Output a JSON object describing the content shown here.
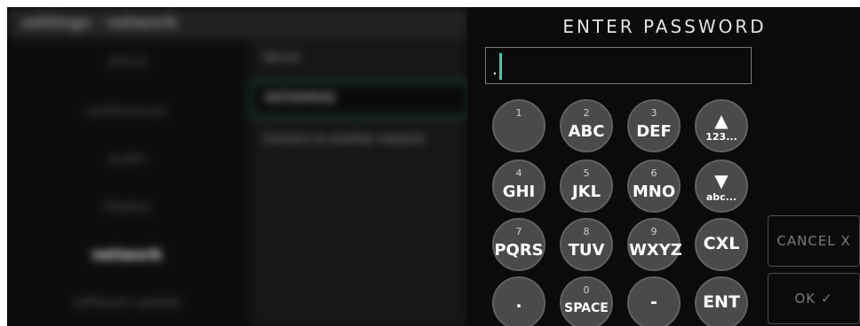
{
  "background": {
    "header": "settings · network",
    "left_menu": [
      "about",
      "preferences",
      "audio",
      "display",
      "network",
      "software update"
    ],
    "active_item": "network",
    "right_items": [
      "Server",
      "ENTERPRISE",
      "Connect to another network"
    ]
  },
  "dialog": {
    "title": "ENTER PASSWORD",
    "field_value": "."
  },
  "keypad": [
    {
      "num": "1",
      "label": ""
    },
    {
      "num": "2",
      "label": "ABC"
    },
    {
      "num": "3",
      "label": "DEF"
    },
    {
      "num": "",
      "label": "123...",
      "icon": "▲"
    },
    {
      "num": "4",
      "label": "GHI"
    },
    {
      "num": "5",
      "label": "JKL"
    },
    {
      "num": "6",
      "label": "MNO"
    },
    {
      "num": "",
      "label": "abc...",
      "icon": "▼"
    },
    {
      "num": "7",
      "label": "PQRS"
    },
    {
      "num": "8",
      "label": "TUV"
    },
    {
      "num": "9",
      "label": "WXYZ"
    },
    {
      "num": "",
      "label": "CXL"
    },
    {
      "num": "",
      "label": "."
    },
    {
      "num": "0",
      "label": "SPACE"
    },
    {
      "num": "",
      "label": "-"
    },
    {
      "num": "",
      "label": "ENT"
    }
  ],
  "buttons": {
    "cancel": "CANCEL X",
    "ok": "OK ✓"
  },
  "colors": {
    "cursor": "#2ad6b0",
    "key_fill": "#4a4a4a",
    "panel_bg": "#0b0b0b"
  }
}
